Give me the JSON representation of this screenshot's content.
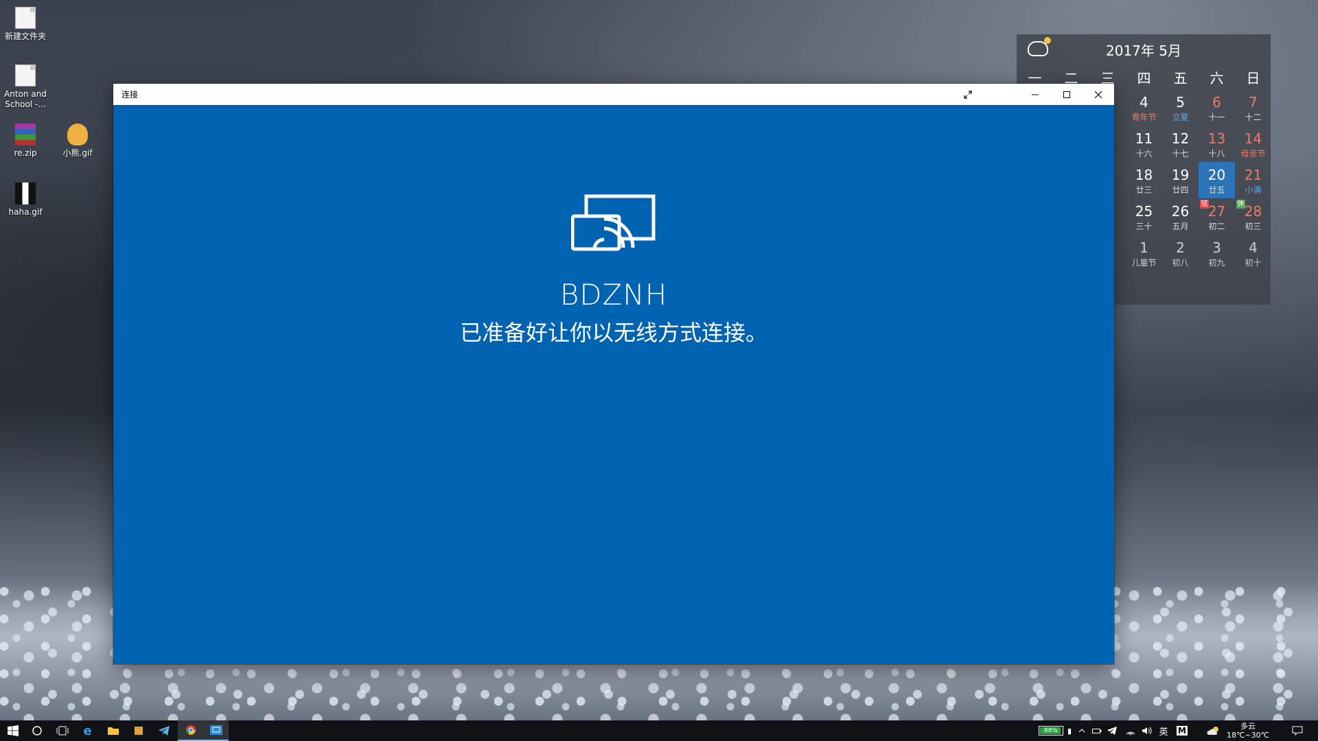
{
  "desktop": {
    "icons": [
      {
        "label": "新建文件夹"
      },
      {
        "label": "Anton and School -..."
      },
      {
        "label": "re.zip"
      },
      {
        "label": "小熊.gif"
      },
      {
        "label": "haha.gif"
      }
    ]
  },
  "calendar": {
    "title": "2017年 5月",
    "weekdays": [
      "一",
      "二",
      "三",
      "四",
      "五",
      "六",
      "日"
    ],
    "rows": [
      [
        {
          "d": "",
          "l": ""
        },
        {
          "d": "",
          "l": ""
        },
        {
          "d": "",
          "l": ""
        },
        {
          "d": "4",
          "l": "青年节"
        },
        {
          "d": "5",
          "l": "立夏"
        },
        {
          "d": "6",
          "l": "十一"
        },
        {
          "d": "7",
          "l": "十二"
        }
      ],
      [
        {
          "d": "",
          "l": ""
        },
        {
          "d": "",
          "l": ""
        },
        {
          "d": "",
          "l": ""
        },
        {
          "d": "11",
          "l": "十六"
        },
        {
          "d": "12",
          "l": "十七"
        },
        {
          "d": "13",
          "l": "十八"
        },
        {
          "d": "14",
          "l": "母亲节"
        }
      ],
      [
        {
          "d": "",
          "l": ""
        },
        {
          "d": "",
          "l": ""
        },
        {
          "d": "",
          "l": ""
        },
        {
          "d": "18",
          "l": "廿三"
        },
        {
          "d": "19",
          "l": "廿四"
        },
        {
          "d": "20",
          "l": "廿五"
        },
        {
          "d": "21",
          "l": "小满"
        }
      ],
      [
        {
          "d": "",
          "l": ""
        },
        {
          "d": "",
          "l": ""
        },
        {
          "d": "",
          "l": ""
        },
        {
          "d": "25",
          "l": "三十"
        },
        {
          "d": "26",
          "l": "五月"
        },
        {
          "d": "27",
          "l": "初二"
        },
        {
          "d": "28",
          "l": "初三"
        }
      ],
      [
        {
          "d": "",
          "l": ""
        },
        {
          "d": "",
          "l": ""
        },
        {
          "d": "",
          "l": ""
        },
        {
          "d": "1",
          "l": "儿童节"
        },
        {
          "d": "2",
          "l": "初八"
        },
        {
          "d": "3",
          "l": "初九"
        },
        {
          "d": "4",
          "l": "初十"
        }
      ]
    ],
    "badges": {
      "ban": "班",
      "xiu": "休"
    },
    "colors": {
      "today_bg": "#2c73b8",
      "holiday": "#f07a6a",
      "solar_term": "#5aa6ef"
    }
  },
  "window": {
    "title": "连接",
    "device_name": "BDZNH",
    "status": "已准备好让你以无线方式连接。",
    "background": "#0063b1"
  },
  "taskbar": {
    "battery": "88%",
    "ime": "英",
    "ime_mode": "M",
    "weather": "多云",
    "temperature": "18℃~30℃"
  }
}
